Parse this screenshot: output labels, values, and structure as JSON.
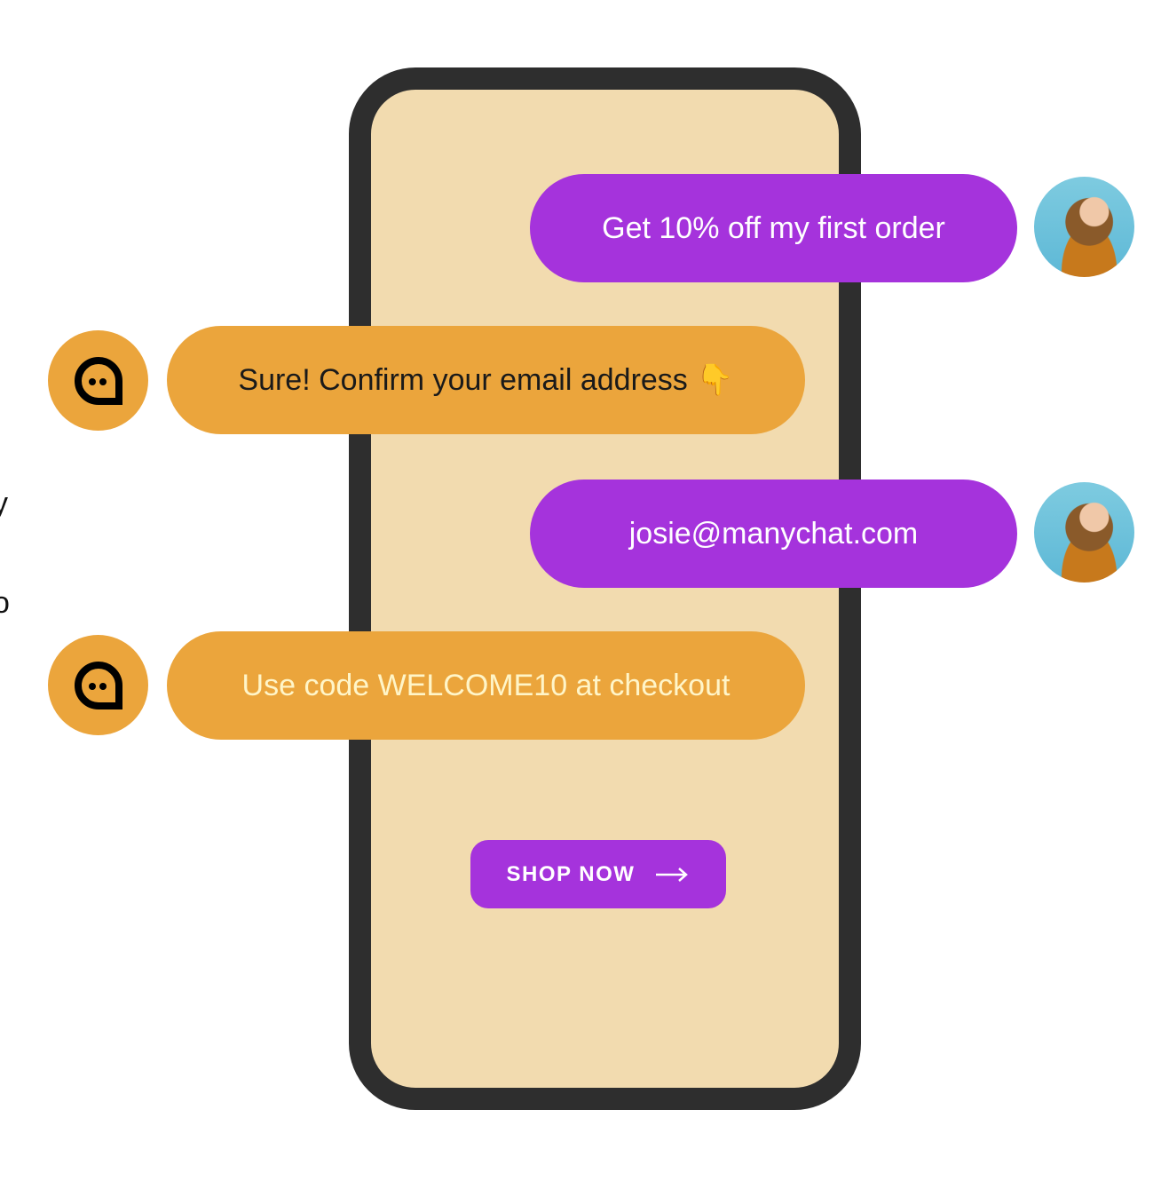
{
  "messages": [
    {
      "sender": "user",
      "text": "Get 10% off my first order"
    },
    {
      "sender": "bot",
      "text": "Sure! Confirm your email address",
      "emoji": "👇"
    },
    {
      "sender": "user",
      "text": "josie@manychat.com"
    },
    {
      "sender": "bot",
      "text": "Use code WELCOME10 at checkout"
    }
  ],
  "cta": {
    "label": "SHOP NOW",
    "icon": "arrow-right-icon"
  },
  "edge_text": [
    "y",
    "o"
  ],
  "colors": {
    "user_bubble": "#a533dc",
    "bot_bubble": "#eba53c",
    "phone_screen": "#f2dbaf",
    "phone_frame": "#2e2e2e"
  }
}
